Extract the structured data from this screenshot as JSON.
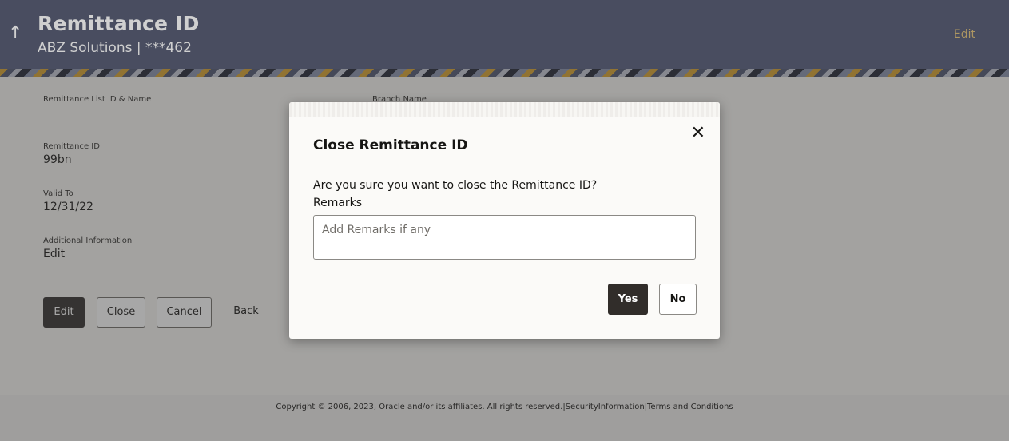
{
  "header": {
    "back_icon": "arrow-up-icon",
    "title": "Remittance ID",
    "subtitle": "ABZ Solutions | ***462",
    "edit_label": "Edit"
  },
  "details": {
    "list_label": "Remittance List ID & Name",
    "branch_label": "Branch Name",
    "remittance_id_label": "Remittance ID",
    "remittance_id_value": "99bn",
    "valid_to_label": "Valid To",
    "valid_to_value": "12/31/22",
    "additional_label": "Additional Information",
    "additional_value": "Edit"
  },
  "actions": {
    "edit": "Edit",
    "close": "Close",
    "cancel": "Cancel",
    "back": "Back"
  },
  "footer": {
    "copyright": "Copyright © 2006, 2023, Oracle and/or its affiliates. All rights reserved.|SecurityInformation|Terms and Conditions"
  },
  "modal": {
    "title": "Close Remittance ID",
    "close_icon": "close-icon",
    "question": "Are you sure you want to close the Remittance ID?",
    "remarks_label": "Remarks",
    "remarks_placeholder": "Add Remarks if any",
    "remarks_value": "",
    "yes_label": "Yes",
    "no_label": "No"
  },
  "colors": {
    "header_bg": "#303753",
    "accent_gold": "#c9a657",
    "primary_button": "#312d2a"
  }
}
